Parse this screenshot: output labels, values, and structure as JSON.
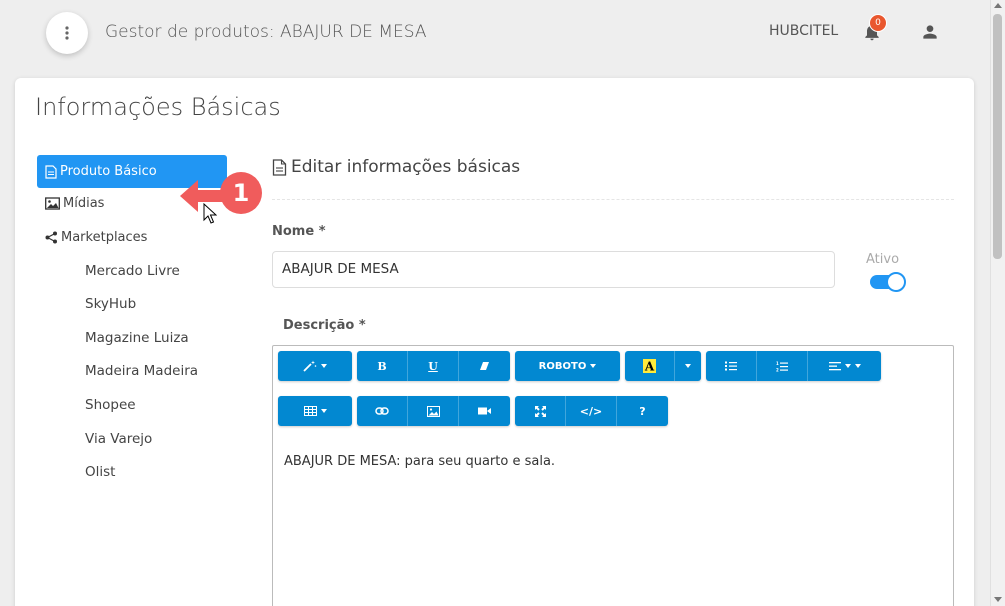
{
  "header": {
    "title": "Gestor de produtos: ABAJUR DE MESA",
    "company": "HUBCITEL",
    "notification_count": "0"
  },
  "card": {
    "title": "Informações Básicas"
  },
  "sidebar": {
    "active_item": "Produto Básico",
    "items": [
      {
        "label": "Mídias",
        "icon": "image-icon"
      },
      {
        "label": "Marketplaces",
        "icon": "share-icon"
      }
    ],
    "marketplaces": [
      "Mercado Livre",
      "SkyHub",
      "Magazine Luiza",
      "Madeira Madeira",
      "Shopee",
      "Via Varejo",
      "Olist"
    ]
  },
  "annotation": {
    "step_number": "1"
  },
  "form": {
    "section_title": "Editar informações básicas",
    "name_label": "Nome *",
    "name_value": "ABAJUR DE MESA",
    "active_label": "Ativo",
    "active": true,
    "description_label": "Descrição *",
    "description_content": "ABAJUR DE MESA: para seu quarto e sala."
  },
  "editor_toolbar": {
    "font_name": "ROBOTO",
    "bold": "B",
    "underline": "U",
    "help": "?",
    "code": "</>"
  },
  "colors": {
    "primary": "#2196f3",
    "toolbar": "#0288d1",
    "badge": "#e9572e",
    "annotation": "#f05c5c"
  }
}
